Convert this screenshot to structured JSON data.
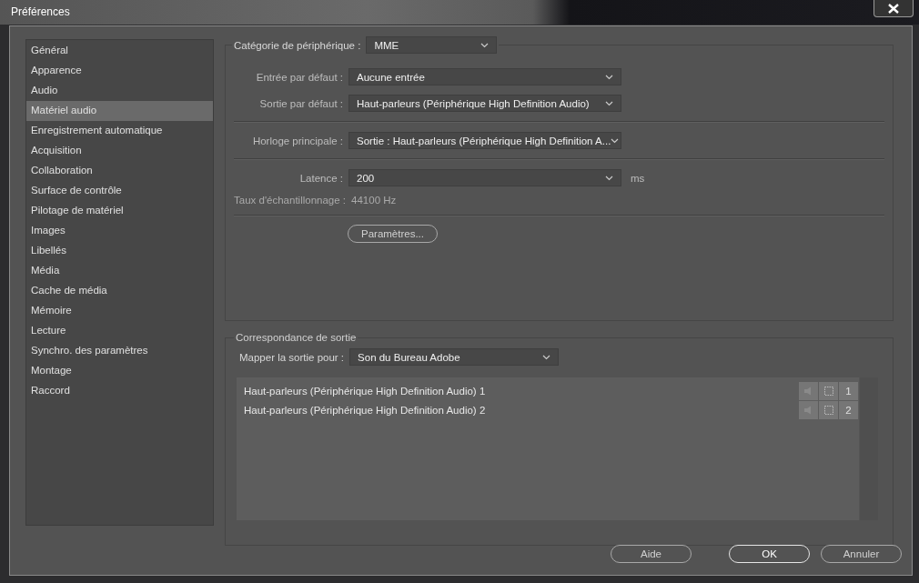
{
  "window": {
    "title": "Préférences"
  },
  "sidebar": {
    "items": [
      {
        "label": "Général",
        "selected": false
      },
      {
        "label": "Apparence",
        "selected": false
      },
      {
        "label": "Audio",
        "selected": false
      },
      {
        "label": "Matériel audio",
        "selected": true
      },
      {
        "label": "Enregistrement automatique",
        "selected": false
      },
      {
        "label": "Acquisition",
        "selected": false
      },
      {
        "label": "Collaboration",
        "selected": false
      },
      {
        "label": "Surface de contrôle",
        "selected": false
      },
      {
        "label": "Pilotage de matériel",
        "selected": false
      },
      {
        "label": "Images",
        "selected": false
      },
      {
        "label": "Libellés",
        "selected": false
      },
      {
        "label": "Média",
        "selected": false
      },
      {
        "label": "Cache de média",
        "selected": false
      },
      {
        "label": "Mémoire",
        "selected": false
      },
      {
        "label": "Lecture",
        "selected": false
      },
      {
        "label": "Synchro. des paramètres",
        "selected": false
      },
      {
        "label": "Montage",
        "selected": false
      },
      {
        "label": "Raccord",
        "selected": false
      }
    ]
  },
  "device": {
    "category_label": "Catégorie de périphérique :",
    "category_value": "MME",
    "groups": [
      [
        {
          "kind": "dropdown",
          "label": "Entrée par défaut :",
          "value": "Aucune entrée"
        },
        {
          "kind": "dropdown",
          "label": "Sortie par défaut :",
          "value": "Haut-parleurs (Périphérique High Definition Audio)"
        }
      ],
      [
        {
          "kind": "dropdown",
          "label": "Horloge principale :",
          "value": "Sortie : Haut-parleurs (Périphérique High Definition A..."
        }
      ],
      [
        {
          "kind": "dropdown",
          "label": "Latence :",
          "value": "200",
          "unit": "ms"
        },
        {
          "kind": "info",
          "label": "Taux d'échantillonnage :",
          "value": "44100 Hz"
        }
      ],
      [
        {
          "kind": "button",
          "value": "Paramètres..."
        }
      ]
    ]
  },
  "output_mapping": {
    "title": "Correspondance de sortie",
    "map_label": "Mapper la sortie pour :",
    "map_value": "Son du Bureau Adobe",
    "outputs": [
      {
        "label": "Haut-parleurs (Périphérique High Definition Audio) 1",
        "channel": "1"
      },
      {
        "label": "Haut-parleurs (Périphérique High Definition Audio) 2",
        "channel": "2"
      }
    ]
  },
  "buttons": [
    {
      "label": "Aide",
      "default": false
    },
    {
      "label": "OK",
      "default": true
    },
    {
      "label": "Annuler",
      "default": false
    }
  ]
}
